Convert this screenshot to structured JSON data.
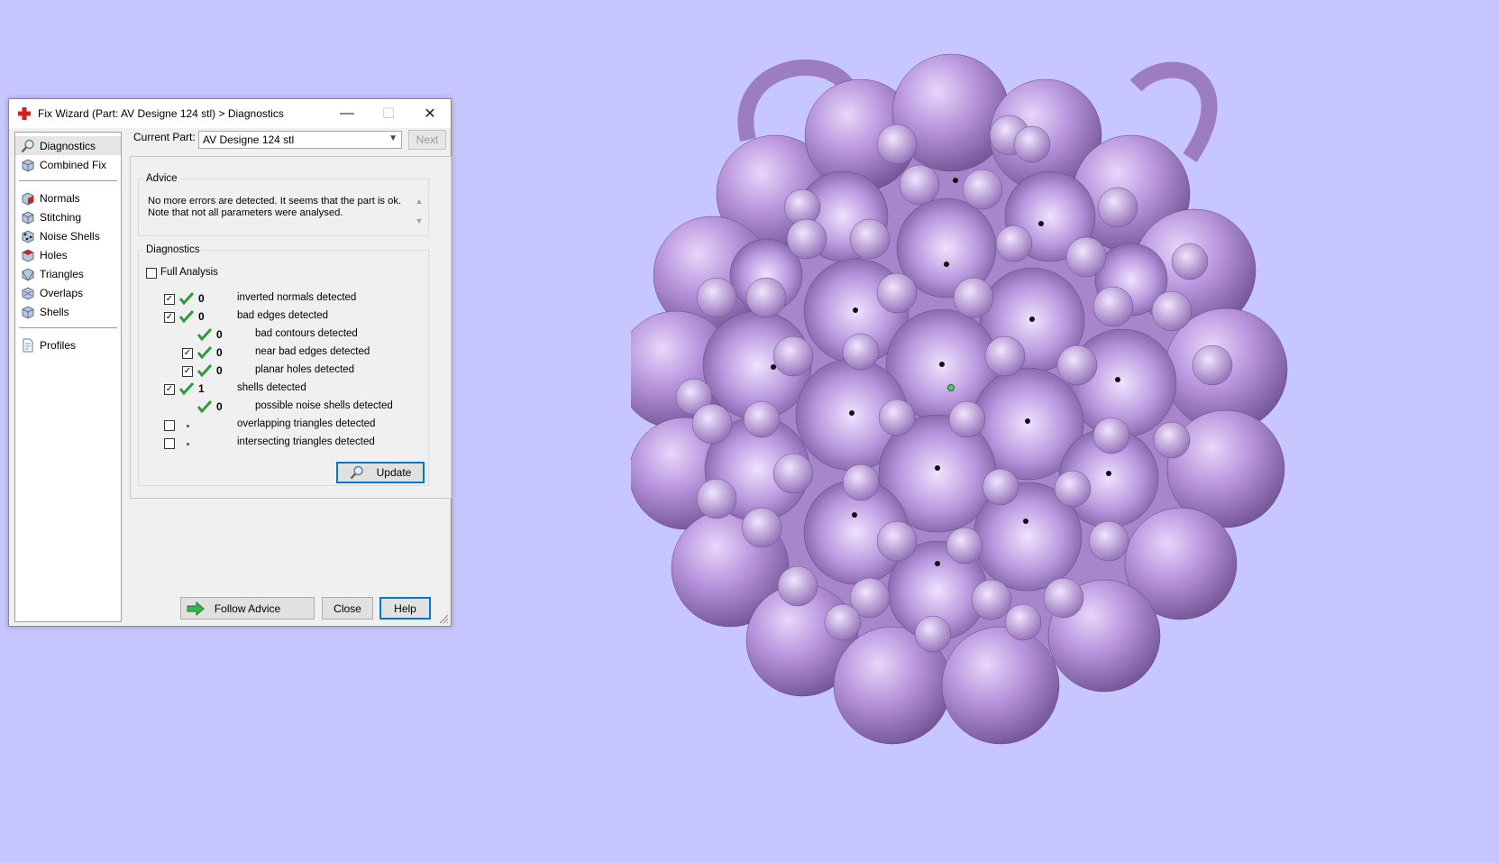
{
  "window": {
    "title": "Fix Wizard (Part: AV Designe 124 stl) > Diagnostics",
    "minimize_glyph": "—",
    "maximize_glyph": "☐",
    "close_glyph": "✕"
  },
  "sidebar": {
    "items": [
      {
        "label": "Diagnostics",
        "icon": "magnifier-icon",
        "active": true
      },
      {
        "label": "Combined Fix",
        "icon": "cube-icon"
      },
      {
        "label": "Normals",
        "icon": "normals-cube-icon"
      },
      {
        "label": "Stitching",
        "icon": "stitching-cube-icon"
      },
      {
        "label": "Noise Shells",
        "icon": "noise-shells-icon"
      },
      {
        "label": "Holes",
        "icon": "holes-cube-icon"
      },
      {
        "label": "Triangles",
        "icon": "triangles-cube-icon"
      },
      {
        "label": "Overlaps",
        "icon": "overlaps-cube-icon"
      },
      {
        "label": "Shells",
        "icon": "shells-cube-icon"
      },
      {
        "label": "Profiles",
        "icon": "profiles-page-icon"
      }
    ]
  },
  "current_part": {
    "label": "Current Part:",
    "value": "AV Designe 124 stl",
    "next_label": "Next"
  },
  "advice": {
    "legend": "Advice",
    "line1": "No more errors are detected. It seems that the part is ok.",
    "line2": "Note that not all parameters were analysed."
  },
  "diagnostics": {
    "legend": "Diagnostics",
    "full_analysis_label": "Full Analysis",
    "full_analysis_checked": false,
    "rows": [
      {
        "text": "inverted normals detected",
        "count": "0",
        "checked": true,
        "status": "ok"
      },
      {
        "text": "bad edges detected",
        "count": "0",
        "checked": true,
        "status": "ok"
      },
      {
        "text": "bad contours detected",
        "count": "0",
        "status": "ok"
      },
      {
        "text": "near bad edges detected",
        "count": "0",
        "checked": true,
        "status": "ok"
      },
      {
        "text": "planar holes detected",
        "count": "0",
        "checked": true,
        "status": "ok"
      },
      {
        "text": "shells detected",
        "count": "1",
        "checked": true,
        "status": "ok"
      },
      {
        "text": "possible noise shells detected",
        "count": "0",
        "status": "ok"
      },
      {
        "text": "overlapping triangles detected",
        "count": "",
        "checked": false,
        "status": "not-analysed"
      },
      {
        "text": "intersecting triangles detected",
        "count": "",
        "checked": false,
        "status": "not-analysed"
      }
    ],
    "update_label": "Update"
  },
  "footer": {
    "follow_advice_label": "Follow Advice",
    "close_label": "Close",
    "help_label": "Help"
  },
  "colors": {
    "background": "#c8c6fe",
    "model": "#b08ed0",
    "check_green": "#2f9a3c",
    "focus_blue": "#0078d7"
  }
}
